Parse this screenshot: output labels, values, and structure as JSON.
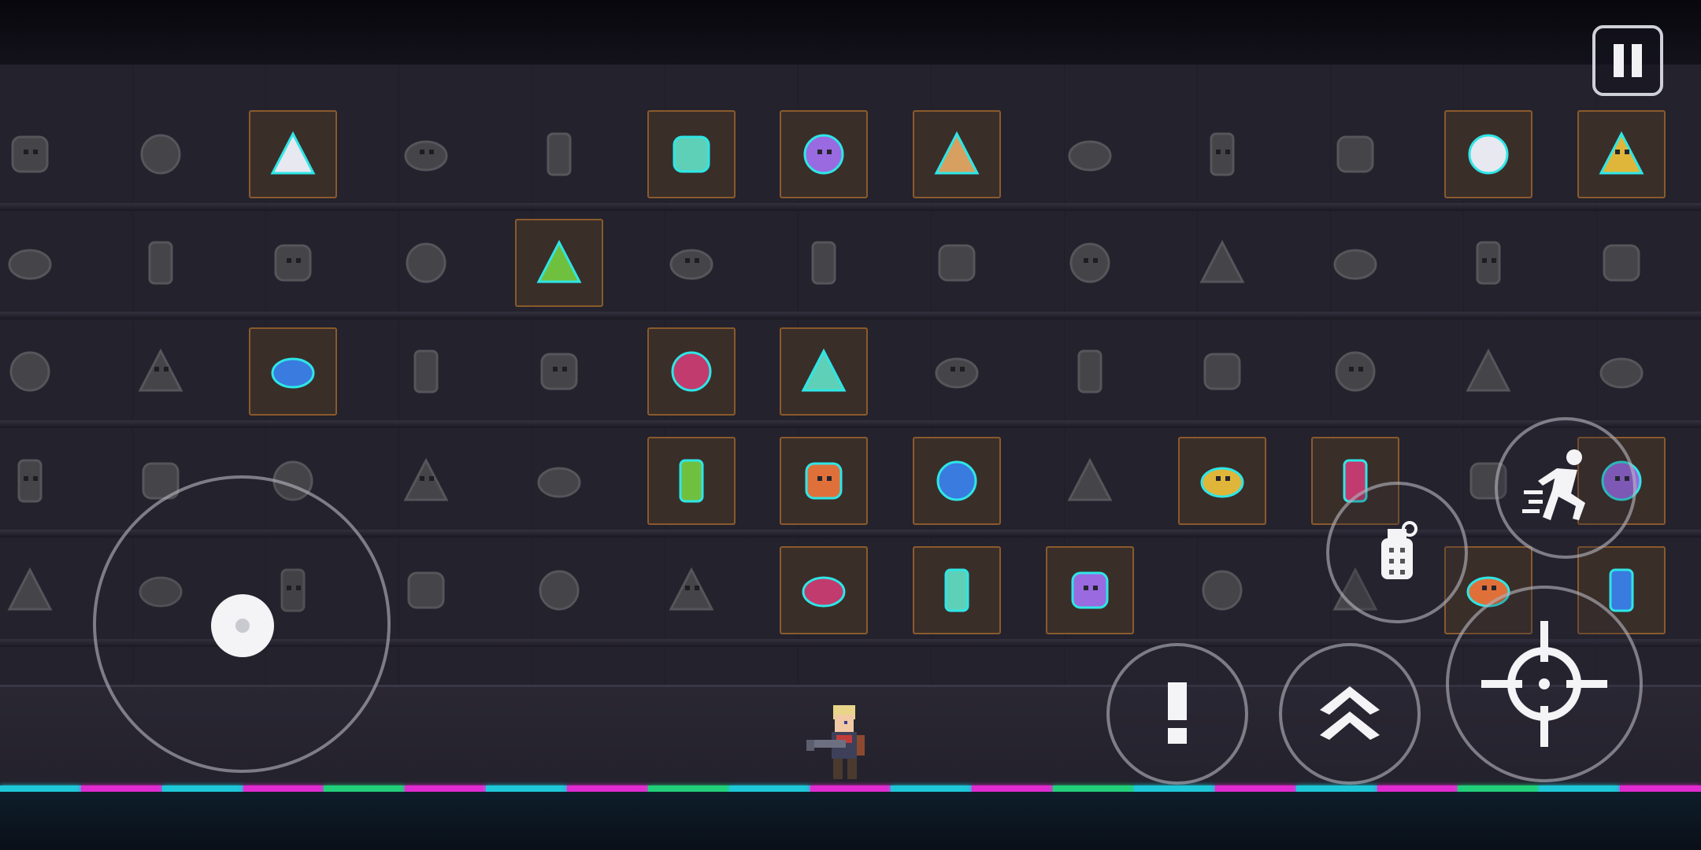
{
  "colors": {
    "wall": "#24222d",
    "owned_slot_border": "#8a5a2c",
    "owned_slot_bg": "#3a2e29",
    "item_glow": "#2ee6e6",
    "neon": [
      "#1ec8d8",
      "#e02bd0",
      "#1ec8d8",
      "#e02bd0",
      "#22d07a",
      "#e02bd0",
      "#1ec8d8",
      "#e02bd0",
      "#22d07a",
      "#1ec8d8",
      "#e02bd0",
      "#1ec8d8",
      "#e02bd0",
      "#22d07a",
      "#1ec8d8",
      "#e02bd0",
      "#1ec8d8",
      "#e02bd0",
      "#22d07a",
      "#1ec8d8",
      "#e02bd0"
    ]
  },
  "pause_button": {
    "icon": "pause-icon"
  },
  "shelf": {
    "rows": [
      [
        {
          "icon": "sticker-icon",
          "owned": false
        },
        {
          "icon": "jar-icon",
          "owned": false
        },
        {
          "icon": "coral-icon",
          "owned": true
        },
        {
          "icon": "mask-icon",
          "owned": false
        },
        {
          "icon": "feather-icon",
          "owned": false
        },
        {
          "icon": "winged-cap-icon",
          "owned": true
        },
        {
          "icon": "astronaut-helmet-icon",
          "owned": true
        },
        {
          "icon": "bird-icon",
          "owned": true
        },
        {
          "icon": "potion-icon",
          "owned": false
        },
        {
          "icon": "toolbox-icon",
          "owned": false
        },
        {
          "icon": "donut-icon",
          "owned": false
        },
        {
          "icon": "clown-icon",
          "owned": true
        },
        {
          "icon": "card-pack-icon",
          "owned": true
        }
      ],
      [
        {
          "icon": "horn-icon",
          "owned": false
        },
        {
          "icon": "bear-skull-icon",
          "owned": false
        },
        {
          "icon": "bandage-icon",
          "owned": false
        },
        {
          "icon": "can-icon",
          "owned": false
        },
        {
          "icon": "pocket-watch-icon",
          "owned": true
        },
        {
          "icon": "round-face-icon",
          "owned": false
        },
        {
          "icon": "frog-face-icon",
          "owned": false
        },
        {
          "icon": "tablet-icon",
          "owned": false
        },
        {
          "icon": "pie-icon",
          "owned": false
        },
        {
          "icon": "poop-icon",
          "owned": false
        },
        {
          "icon": "backpack-icon",
          "owned": false
        },
        {
          "icon": "bottle-icon",
          "owned": false
        },
        {
          "icon": "egg-icon",
          "owned": false
        }
      ],
      [
        {
          "icon": "capsule-icon",
          "owned": false
        },
        {
          "icon": "bottle-figure-icon",
          "owned": false
        },
        {
          "icon": "spicy-heart-icon",
          "owned": true
        },
        {
          "icon": "joystick-icon",
          "owned": false
        },
        {
          "icon": "owl-icon",
          "owned": false
        },
        {
          "icon": "screen-icon",
          "owned": true
        },
        {
          "icon": "ninja-mask-icon",
          "owned": true
        },
        {
          "icon": "apple-icon",
          "owned": false
        },
        {
          "icon": "drop-icon",
          "owned": false
        },
        {
          "icon": "teddy-icon",
          "owned": false
        },
        {
          "icon": "doll-icon",
          "owned": false
        },
        {
          "icon": "burger-icon",
          "owned": false
        },
        {
          "icon": "ice-cream-icon",
          "owned": false
        }
      ],
      [
        {
          "icon": "gameboy-icon",
          "owned": false
        },
        {
          "icon": "phone-icon",
          "owned": false
        },
        {
          "icon": "box-icon",
          "owned": false
        },
        {
          "icon": "grill-icon",
          "owned": false
        },
        {
          "icon": "cap-icon",
          "owned": false
        },
        {
          "icon": "boot-icon",
          "owned": true
        },
        {
          "icon": "ticket-icon",
          "owned": true
        },
        {
          "icon": "bread-icon",
          "owned": true
        },
        {
          "icon": "candy-cane-icon",
          "owned": false
        },
        {
          "icon": "lion-icon",
          "owned": true
        },
        {
          "icon": "honey-jar-icon",
          "owned": true
        },
        {
          "icon": "bug-icon",
          "owned": false
        },
        {
          "icon": "roast-chicken-icon",
          "owned": true
        }
      ],
      [
        {
          "icon": "mushroom-icon",
          "owned": false
        },
        {
          "icon": "crystal-icon",
          "owned": false
        },
        {
          "icon": "chest-icon",
          "owned": false
        },
        {
          "icon": "bag-icon",
          "owned": false
        },
        {
          "icon": "magnifier-icon",
          "owned": false
        },
        {
          "icon": "note-icon",
          "owned": false
        },
        {
          "icon": "flame-spirit-icon",
          "owned": true
        },
        {
          "icon": "ring-icon",
          "owned": true
        },
        {
          "icon": "cookie-icon",
          "owned": true
        },
        {
          "icon": "tree-icon",
          "owned": false
        },
        {
          "icon": "ufo-icon",
          "owned": false
        },
        {
          "icon": "cheesecake-icon",
          "owned": true
        },
        {
          "icon": "fried-egg-icon",
          "owned": true
        }
      ]
    ]
  },
  "player": {
    "icon": "knight-character-icon"
  },
  "controls": {
    "joystick": {
      "icon": "joystick-knob-icon"
    },
    "interact_button": {
      "icon": "exclamation-icon"
    },
    "jump_button": {
      "icon": "double-chevron-up-icon"
    },
    "grenade_button": {
      "icon": "grenade-icon"
    },
    "dash_button": {
      "icon": "dash-runner-icon"
    },
    "fire_button": {
      "icon": "crosshair-icon"
    }
  }
}
